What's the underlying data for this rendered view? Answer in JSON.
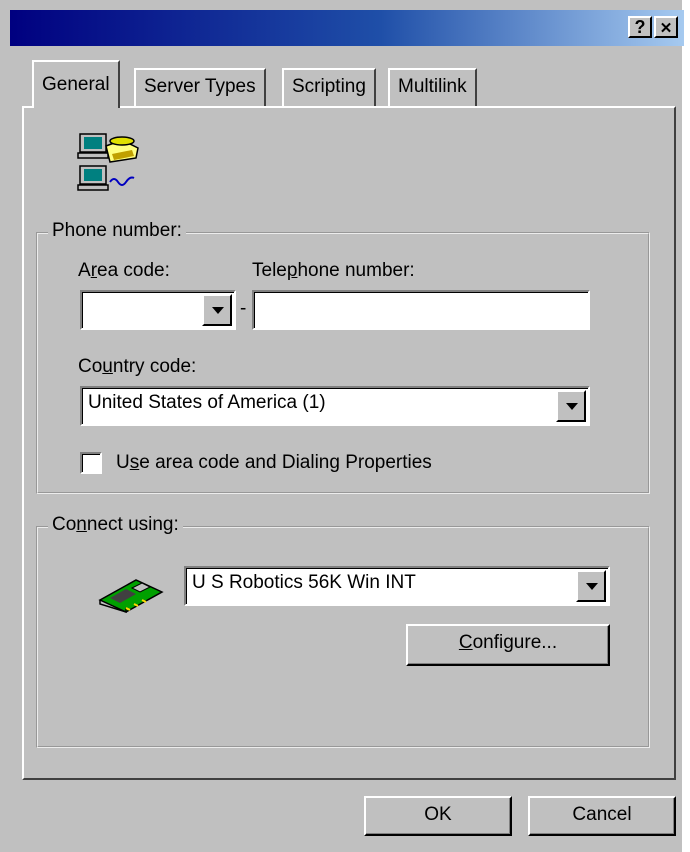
{
  "title_bar": {
    "help_label": "?",
    "close_label": "✕"
  },
  "tabs": [
    {
      "label": "General"
    },
    {
      "label": "Server Types"
    },
    {
      "label": "Scripting"
    },
    {
      "label": "Multilink"
    }
  ],
  "phone": {
    "group_label": "Phone number:",
    "area_code": {
      "pre": "A",
      "key": "r",
      "post": "ea code:",
      "value": ""
    },
    "separator": "-",
    "telephone": {
      "pre": "Tele",
      "key": "p",
      "post": "hone number:",
      "value": ""
    },
    "country": {
      "pre": "Co",
      "key": "u",
      "post": "ntry code:",
      "value": "United States of America (1)"
    },
    "use_area": {
      "pre": "U",
      "key": "s",
      "post": "e area code and Dialing Properties",
      "checked": false
    }
  },
  "connect": {
    "group_label_pre": "Co",
    "group_label_key": "n",
    "group_label_post": "nect using:",
    "device": "U S Robotics 56K Win INT",
    "configure_key": "C",
    "configure_post": "onfigure..."
  },
  "footer": {
    "ok_label": "OK",
    "cancel_label": "Cancel"
  },
  "icons": [
    "dialup-networking-icon",
    "modem-card-icon",
    "dropdown-arrow-icon"
  ],
  "colors": {
    "face": "#c0c0c0",
    "title_start": "#000080",
    "title_end": "#a6caf0"
  }
}
